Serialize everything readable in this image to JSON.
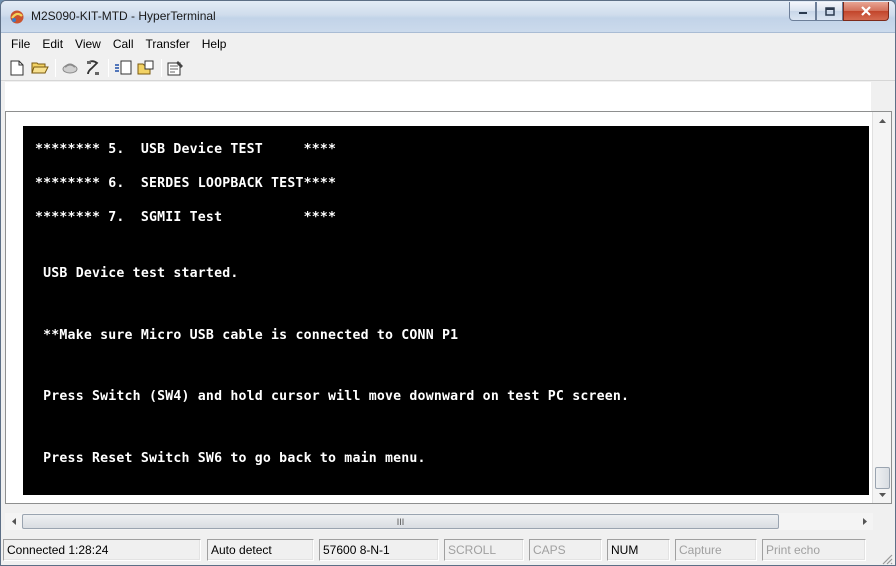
{
  "window": {
    "title": "M2S090-KIT-MTD - HyperTerminal",
    "app_icon": "hyperterminal-icon",
    "controls": [
      "minimize-icon",
      "maximize-icon",
      "close-icon"
    ]
  },
  "menu": [
    "File",
    "Edit",
    "View",
    "Call",
    "Transfer",
    "Help"
  ],
  "toolbar": {
    "icons": [
      "new-connection-icon",
      "open-icon",
      "disconnect-icon",
      "dial-icon",
      "send-icon",
      "receive-icon",
      "properties-icon"
    ]
  },
  "terminal": {
    "lines": [
      "******** 5.  USB Device TEST     ****",
      "******** 6.  SERDES LOOPBACK TEST****",
      "******** 7.  SGMII Test          ****",
      " USB Device test started.",
      " **Make sure Micro USB cable is connected to CONN P1",
      " Press Switch (SW4) and hold cursor will move downward on test PC screen.",
      " Press Reset Switch SW6 to go back to main menu."
    ],
    "background": "#000000",
    "foreground": "#ffffff"
  },
  "scrollbar": {
    "h_thumb_grip": "III"
  },
  "status": {
    "connection": "Connected 1:28:24",
    "detect": "Auto detect",
    "settings": "57600 8-N-1",
    "scroll": "SCROLL",
    "caps": "CAPS",
    "num": "NUM",
    "capture": "Capture",
    "print_echo": "Print echo"
  }
}
